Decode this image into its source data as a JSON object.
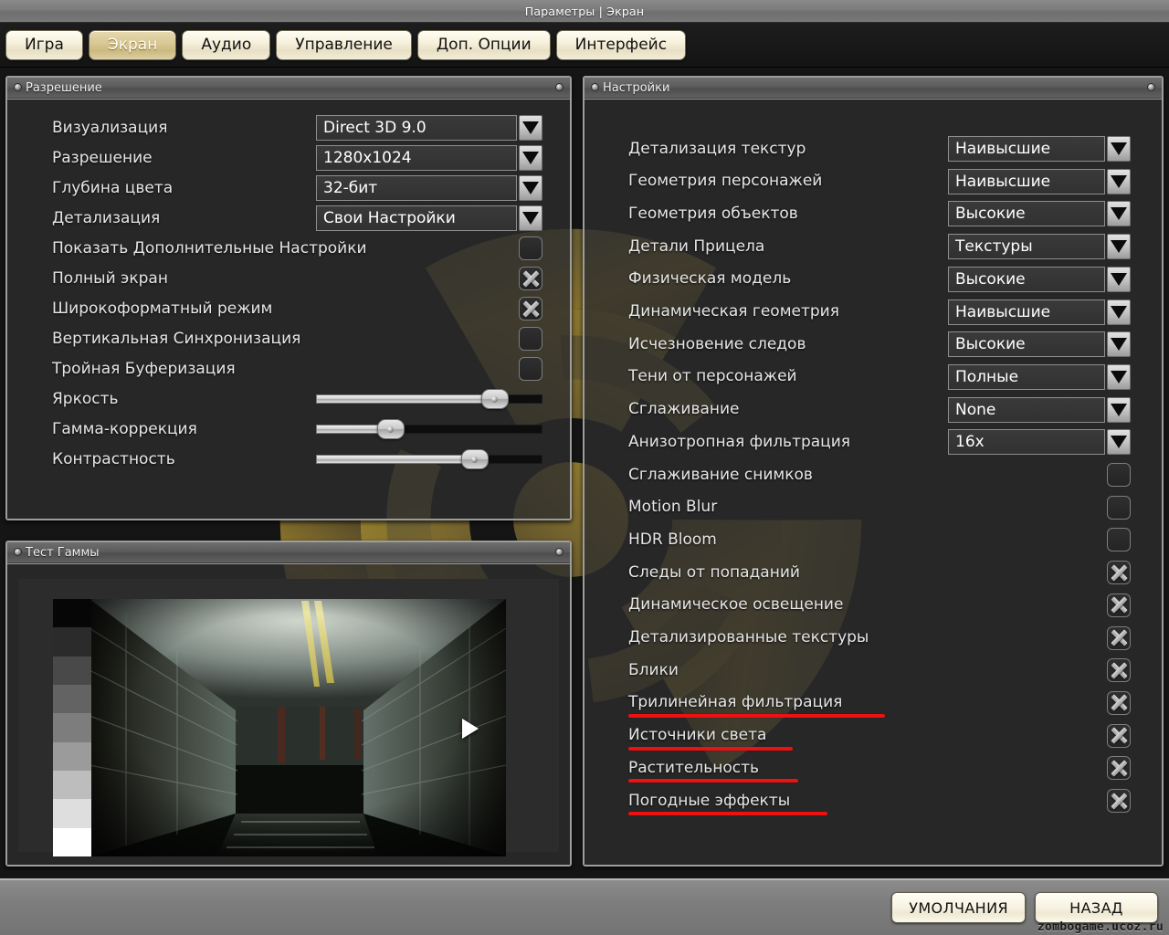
{
  "window": {
    "title": "Параметры | Экран"
  },
  "tabs": [
    {
      "label": "Игра",
      "active": false
    },
    {
      "label": "Экран",
      "active": true
    },
    {
      "label": "Аудио",
      "active": false
    },
    {
      "label": "Управление",
      "active": false
    },
    {
      "label": "Доп. Опции",
      "active": false
    },
    {
      "label": "Интерфейс",
      "active": false
    }
  ],
  "resolution_panel": {
    "title": "Разрешение",
    "rows": [
      {
        "label": "Визуализация",
        "type": "dropdown",
        "value": "Direct 3D 9.0"
      },
      {
        "label": "Разрешение",
        "type": "dropdown",
        "value": "1280x1024"
      },
      {
        "label": "Глубина цвета",
        "type": "dropdown",
        "value": "32-бит"
      },
      {
        "label": "Детализация",
        "type": "dropdown",
        "value": "Свои Настройки"
      },
      {
        "label": "Показать Дополнительные Настройки",
        "type": "checkbox",
        "checked": false
      },
      {
        "label": "Полный экран",
        "type": "checkbox",
        "checked": true
      },
      {
        "label": "Широкоформатный режим",
        "type": "checkbox",
        "checked": true
      },
      {
        "label": "Вертикальная Синхронизация",
        "type": "checkbox",
        "checked": false
      },
      {
        "label": "Тройная Буферизация",
        "type": "checkbox",
        "checked": false
      },
      {
        "label": "Яркость",
        "type": "slider",
        "percent": 79
      },
      {
        "label": "Гамма-коррекция",
        "type": "slider",
        "percent": 33
      },
      {
        "label": "Контрастность",
        "type": "slider",
        "percent": 70
      }
    ]
  },
  "gamma_panel": {
    "title": "Тест Гаммы",
    "ramp_steps": [
      "#060606",
      "#2b2b2b",
      "#494949",
      "#636363",
      "#7d7d7d",
      "#9b9b9b",
      "#bdbdbd",
      "#dedede",
      "#ffffff"
    ]
  },
  "settings_panel": {
    "title": "Настройки",
    "rows": [
      {
        "label": "Детализация текстур",
        "type": "dropdown",
        "value": "Наивысшие"
      },
      {
        "label": "Геометрия персонажей",
        "type": "dropdown",
        "value": "Наивысшие"
      },
      {
        "label": "Геометрия объектов",
        "type": "dropdown",
        "value": "Высокие"
      },
      {
        "label": "Детали Прицела",
        "type": "dropdown",
        "value": "Текстуры"
      },
      {
        "label": "Физическая модель",
        "type": "dropdown",
        "value": "Высокие"
      },
      {
        "label": "Динамическая геометрия",
        "type": "dropdown",
        "value": "Наивысшие"
      },
      {
        "label": "Исчезновение следов",
        "type": "dropdown",
        "value": "Высокие"
      },
      {
        "label": "Тени от персонажей",
        "type": "dropdown",
        "value": "Полные"
      },
      {
        "label": "Сглаживание",
        "type": "dropdown",
        "value": "None"
      },
      {
        "label": "Анизотропная фильтрация",
        "type": "dropdown",
        "value": "16x"
      },
      {
        "label": "Сглаживание снимков",
        "type": "checkbox",
        "checked": false
      },
      {
        "label": "Motion Blur",
        "type": "checkbox",
        "checked": false
      },
      {
        "label": "HDR Bloom",
        "type": "checkbox",
        "checked": false
      },
      {
        "label": "Следы от попаданий",
        "type": "checkbox",
        "checked": true
      },
      {
        "label": "Динамическое освещение",
        "type": "checkbox",
        "checked": true
      },
      {
        "label": "Детализированные текстуры",
        "type": "checkbox",
        "checked": true
      },
      {
        "label": "Блики",
        "type": "checkbox",
        "checked": true
      },
      {
        "label": "Трилинейная фильтрация",
        "type": "checkbox",
        "checked": true,
        "underline": 281
      },
      {
        "label": "Источники света",
        "type": "checkbox",
        "checked": true,
        "underline": 180
      },
      {
        "label": "Растительность",
        "type": "checkbox",
        "checked": true,
        "underline": 186
      },
      {
        "label": "Погодные эффекты",
        "type": "checkbox",
        "checked": true,
        "underline": 218
      }
    ]
  },
  "footer": {
    "defaults_label": "УМОЛЧАНИЯ",
    "back_label": "НАЗАД",
    "watermark": "zombogame.ucoz.ru"
  },
  "colors": {
    "accent_tab": "#d8c793",
    "underline_red": "#ee1111",
    "panel_border": "#9d9d9d",
    "text": "#e6e6e6"
  }
}
